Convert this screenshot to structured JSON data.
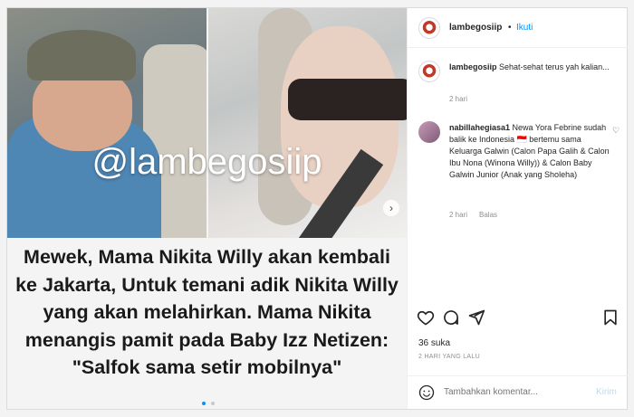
{
  "media": {
    "watermark": "@lambegosiip",
    "headline": "Mewek, Mama Nikita Willy akan kembali ke Jakarta, Untuk temani adik Nikita Willy yang akan melahirkan. Mama Nikita menangis pamit pada Baby Izz Netizen: \"Salfok sama setir mobilnya\"",
    "carousel_dots": 2,
    "active_dot": 0
  },
  "header": {
    "username": "lambegosiip",
    "separator": "•",
    "follow_label": "Ikuti"
  },
  "caption": {
    "username": "lambegosiip",
    "text": "Sehat-sehat terus yah kalian...",
    "time": "2 hari"
  },
  "comment": {
    "username": "nabillahegiasa1",
    "text": "Newa Yora Febrine sudah balik ke Indonesia 🇮🇩 bertemu sama Keluarga Galwin (Calon Papa Galih & Calon Ibu Nona (Winona Willy)) & Calon Baby Galwin Junior (Anak yang Sholeha)",
    "time": "2 hari",
    "reply_label": "Balas"
  },
  "stats": {
    "likes": "36 suka",
    "date": "2 HARI YANG LALU"
  },
  "comment_box": {
    "placeholder": "Tambahkan komentar...",
    "send_label": "Kirim"
  },
  "colors": {
    "accent": "#0095f6",
    "text": "#262626",
    "muted": "#8e8e8e"
  }
}
